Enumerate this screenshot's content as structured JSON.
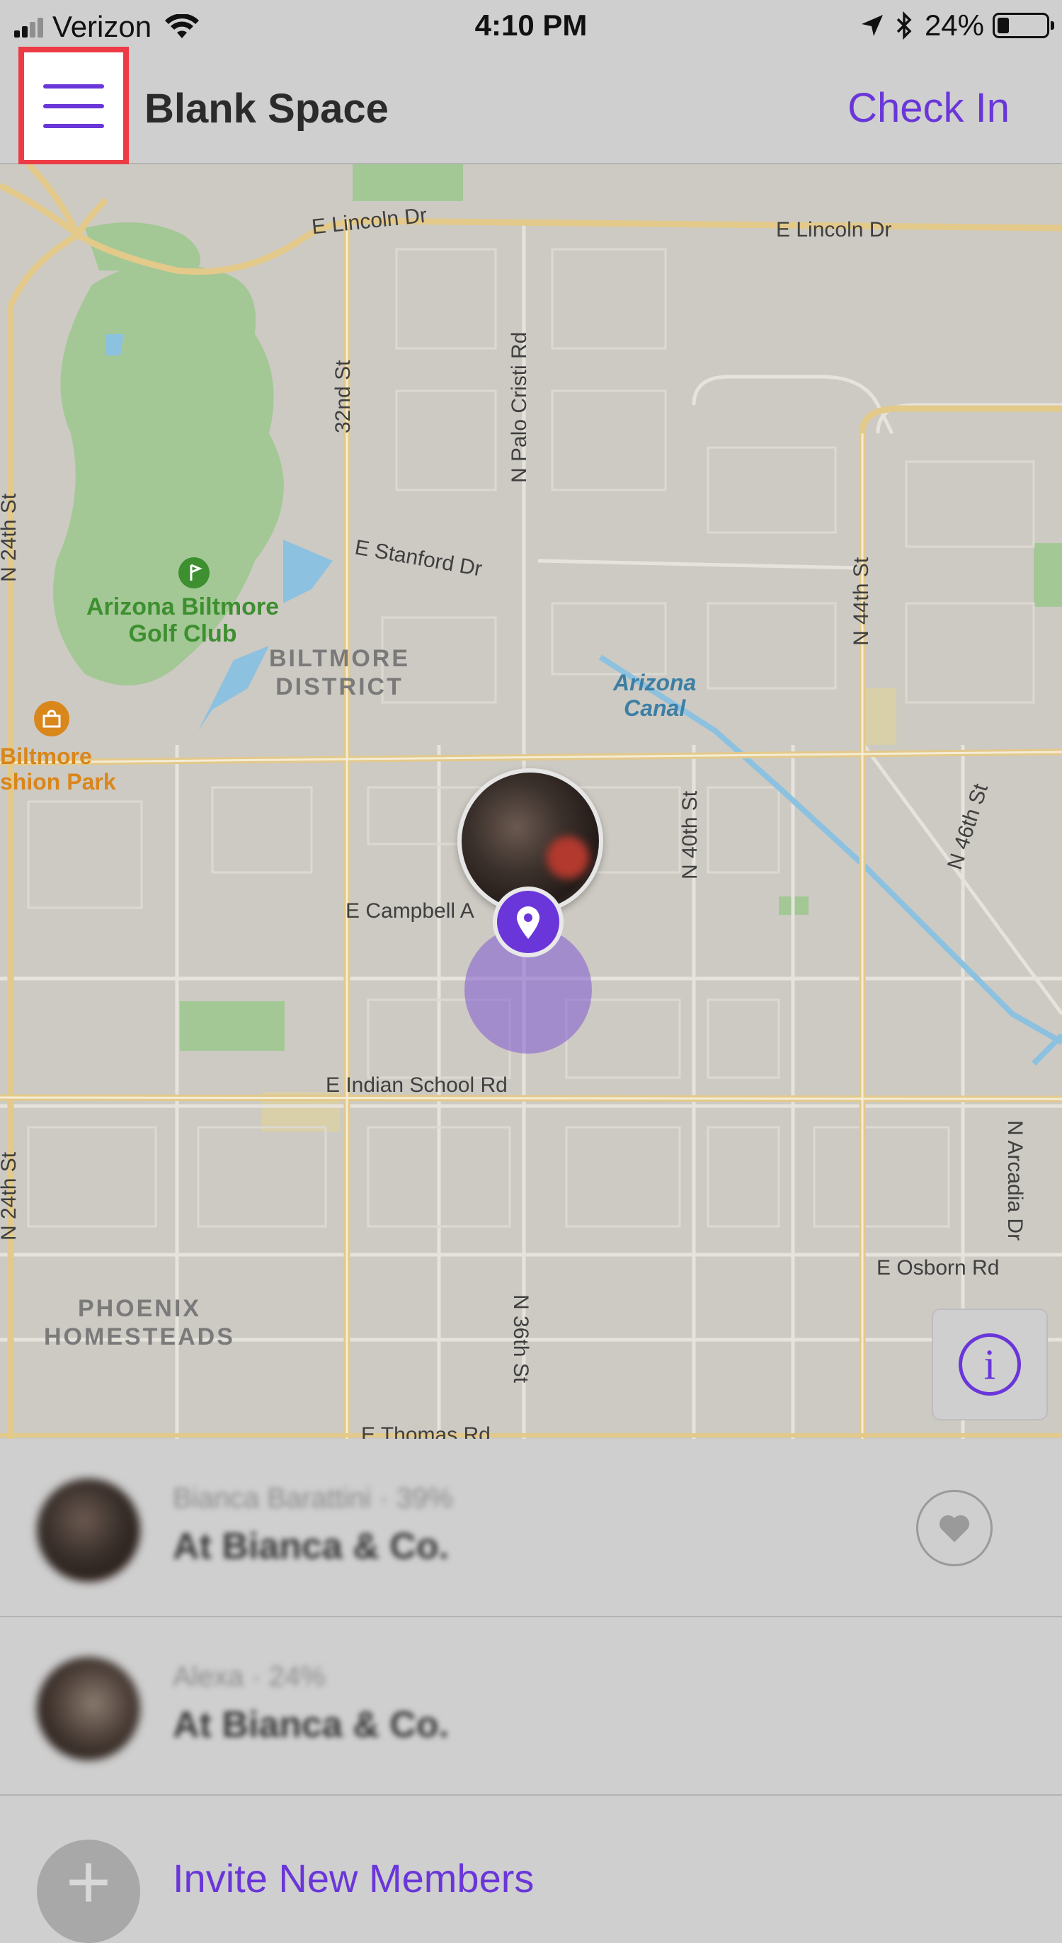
{
  "status_bar": {
    "carrier": "Verizon",
    "time": "4:10 PM",
    "battery_percent": "24%",
    "battery_level": 0.24
  },
  "nav": {
    "title": "Blank Space",
    "check_in": "Check In",
    "menu_icon": "hamburger-menu-icon"
  },
  "map": {
    "street_labels": [
      "E Lincoln Dr",
      "E Lincoln Dr",
      "32nd St",
      "N Palo Cristi Rd",
      "E Stanford Dr",
      "N 44th St",
      "N 24th St",
      "N 40th St",
      "N 46th St",
      "E Campbell A",
      "E Indian School Rd",
      "N 24th St",
      "N Arcadia Dr",
      "E Osborn Rd",
      "N 36th St",
      "E Thomas Rd"
    ],
    "district_1": [
      "BILTMORE",
      "DISTRICT"
    ],
    "district_2": [
      "PHOENIX",
      "HOMESTEADS"
    ],
    "golf": [
      "Arizona Biltmore",
      "Golf Club"
    ],
    "canal": [
      "Arizona",
      "Canal"
    ],
    "mall": [
      "Biltmore",
      "shion Park"
    ],
    "info_icon": "info-icon",
    "water_color": "#8dc1e0",
    "park_color": "#a3c896",
    "major_road_color": "#e3c98a",
    "accent_color": "#6a36d9"
  },
  "members": [
    {
      "name": "Bianca Barattini · 39%",
      "status": "At Bianca & Co."
    },
    {
      "name": "Alexa · 24%",
      "status": "At Bianca & Co."
    }
  ],
  "invite": {
    "label": "Invite New Members"
  }
}
